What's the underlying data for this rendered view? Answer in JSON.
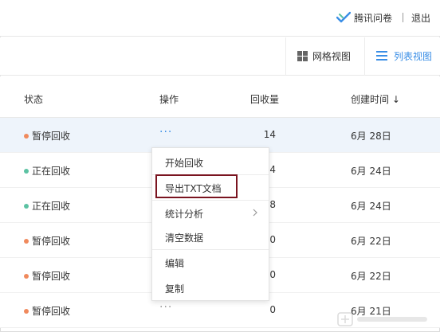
{
  "header": {
    "brand": "腾讯问卷",
    "logout": "退出"
  },
  "view_switch": {
    "grid_label": "网格视图",
    "list_label": "列表视图",
    "active": "list"
  },
  "table": {
    "columns": {
      "status": "状态",
      "ops": "操作",
      "count": "回收量",
      "created": "创建时间 ↓"
    },
    "rows": [
      {
        "status": "暂停回收",
        "dot_color": "#f08a5d",
        "ops": "···",
        "count": "14",
        "date": "6月 28日"
      },
      {
        "status": "正在回收",
        "dot_color": "#5cc2a3",
        "ops": "",
        "count": "4",
        "date": "6月 24日"
      },
      {
        "status": "正在回收",
        "dot_color": "#5cc2a3",
        "ops": "",
        "count": "8",
        "date": "6月 24日"
      },
      {
        "status": "暂停回收",
        "dot_color": "#f08a5d",
        "ops": "",
        "count": "0",
        "date": "6月 22日"
      },
      {
        "status": "暂停回收",
        "dot_color": "#f08a5d",
        "ops": "",
        "count": "0",
        "date": "6月 22日"
      },
      {
        "status": "暂停回收",
        "dot_color": "#f08a5d",
        "ops": "···",
        "count": "0",
        "date": "6月 21日"
      }
    ]
  },
  "dropdown": {
    "items": [
      {
        "label": "开始回收"
      },
      {
        "label": "导出TXT文档"
      },
      {
        "label": "统计分析"
      },
      {
        "label": "清空数据"
      },
      {
        "label": "编辑"
      },
      {
        "label": "复制"
      }
    ]
  },
  "colors": {
    "accent": "#3a8ee6",
    "paused_dot": "#f08a5d",
    "active_dot": "#5cc2a3",
    "highlight_box": "#7a1420"
  }
}
